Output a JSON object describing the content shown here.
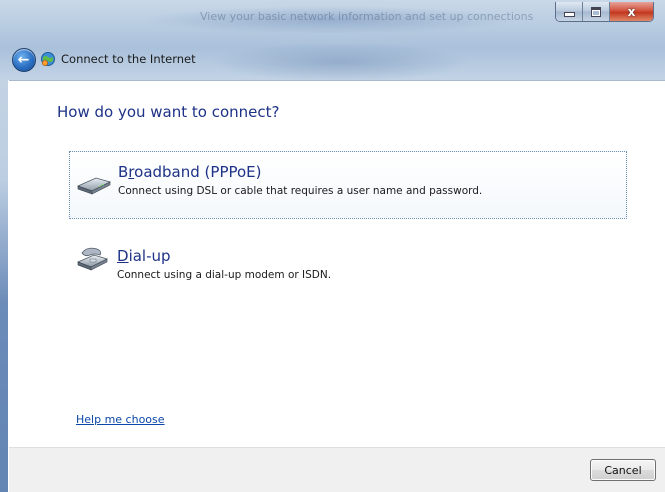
{
  "window": {
    "background_title": "View your basic network information and set up connections",
    "caption": {
      "minimize_icon": "minimize-icon",
      "maximize_icon": "maximize-icon",
      "close_glyph": "x"
    }
  },
  "nav": {
    "back_icon": "back-arrow-icon",
    "title": "Connect to the Internet",
    "title_icon": "network-globe-icon"
  },
  "main": {
    "heading": "How do you want to connect?",
    "options": [
      {
        "title_pre": "B",
        "title_mnemonic": "r",
        "title_post": "oadband (PPPoE)",
        "description": "Connect using DSL or cable that requires a user name and password.",
        "icon": "broadband-modem-icon",
        "selected": true
      },
      {
        "title_pre": "",
        "title_mnemonic": "D",
        "title_post": "ial-up",
        "description": "Connect using a dial-up modem or ISDN.",
        "icon": "dialup-modem-icon",
        "selected": false
      }
    ],
    "help_link": "Help me choose"
  },
  "footer": {
    "cancel_label": "Cancel"
  },
  "colors": {
    "heading": "#1e3287",
    "link": "#0b47a8",
    "close_button": "#c3371f"
  }
}
